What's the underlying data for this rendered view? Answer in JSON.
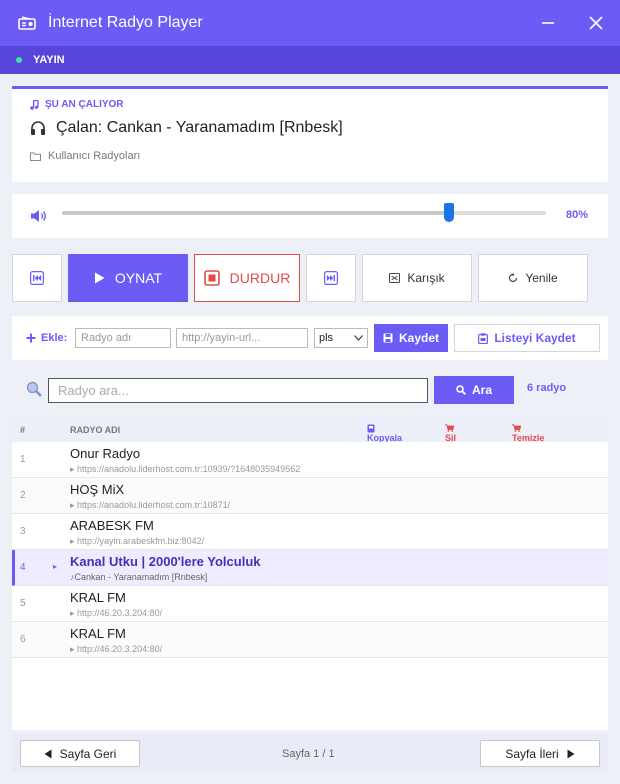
{
  "window": {
    "title": "İnternet Radyo Player",
    "minimize_glyph": "—",
    "close_glyph": "✕"
  },
  "status": {
    "label": "YAYIN",
    "dot_color": "#3ee7a0"
  },
  "now_playing": {
    "section_label": "ŞU AN ÇALIYOR",
    "track": "Çalan: Cankan - Yaranamadım [Rnbesk]",
    "folder": "Kullanıcı Radyoları"
  },
  "volume": {
    "level": 0.8,
    "label": "80%"
  },
  "controls": {
    "play": "OYNAT",
    "stop": "DURDUR",
    "shuffle": "Karışık",
    "refresh": "Yenile"
  },
  "add": {
    "label": "Ekle:",
    "name_placeholder": "Radyo adı",
    "url_placeholder": "http://yayin-url...",
    "format_selected": "pls",
    "save": "Kaydet",
    "save_list": "Listeyi Kaydet"
  },
  "search": {
    "placeholder": "Radyo ara...",
    "button": "Ara",
    "count": "6 radyo"
  },
  "list": {
    "headers": {
      "num": "#",
      "name": "RADYO ADI",
      "copy": "Kopyala",
      "delete": "Sil",
      "clear": "Temizle"
    },
    "rows": [
      {
        "num": "1",
        "name": "Onur Radyo",
        "sub": "https://anadolu.liderhost.com.tr:10939/?1648035949562"
      },
      {
        "num": "2",
        "name": "HOŞ MiX",
        "sub": "https://anadolu.liderhost.com.tr:10871/"
      },
      {
        "num": "3",
        "name": "ARABESK FM",
        "sub": "http://yayin.arabeskfm.biz:8042/"
      },
      {
        "num": "4",
        "name": "Kanal Utku | 2000'lere Yolculuk",
        "sub": "Cankan - Yaranamadım [Rnbesk]",
        "active": true
      },
      {
        "num": "5",
        "name": "KRAL FM",
        "sub": "http://46.20.3.204:80/"
      },
      {
        "num": "6",
        "name": "KRAL FM",
        "sub": "http://46.20.3.204:80/"
      }
    ]
  },
  "pagination": {
    "prev": "Sayfa Geri",
    "next": "Sayfa İleri",
    "info": "Sayfa 1 / 1"
  },
  "colors": {
    "accent": "#6b5cf6",
    "accent_dark": "#5646d9",
    "danger": "#e44a4a",
    "slider_thumb": "#1a73e8"
  }
}
